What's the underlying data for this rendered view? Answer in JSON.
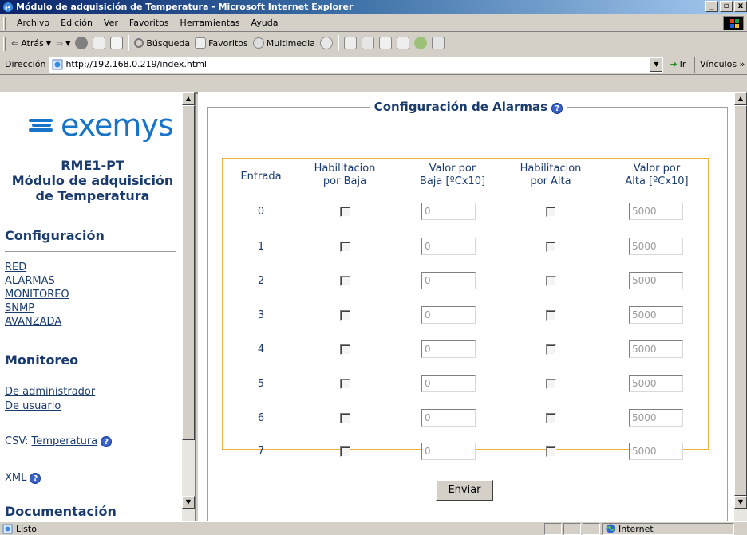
{
  "window": {
    "title": "Módulo de adquisición de Temperatura - Microsoft Internet Explorer",
    "controls": [
      "_",
      "▫",
      "x"
    ]
  },
  "menubar": [
    "Archivo",
    "Edición",
    "Ver",
    "Favoritos",
    "Herramientas",
    "Ayuda"
  ],
  "toolbar": {
    "back": "Atrás",
    "search": "Búsqueda",
    "favorites": "Favoritos",
    "multimedia": "Multimedia"
  },
  "address": {
    "label": "Dirección",
    "url": "http://192.168.0.219/index.html",
    "go": "Ir",
    "links": "Vínculos"
  },
  "sidebar": {
    "brand": "exemys",
    "product_line1": "RME1-PT",
    "product_line2": "Módulo de adquisición",
    "product_line3": "de Temperatura",
    "config_title": "Configuración",
    "config_links": [
      "RED",
      "ALARMAS",
      "MONITOREO",
      "SNMP",
      "AVANZADA"
    ],
    "monitor_title": "Monitoreo",
    "monitor_links": [
      "De administrador",
      "De usuario"
    ],
    "csv_prefix": "CSV:",
    "csv_link": "Temperatura",
    "xml_link": "XML",
    "doc_title": "Documentación"
  },
  "main": {
    "legend": "Configuración de Alarmas",
    "headers": {
      "entrada": "Entrada",
      "hab_baja_1": "Habilitacion",
      "hab_baja_2": "por Baja",
      "val_baja_1": "Valor por",
      "val_baja_2": "Baja [ºCx10]",
      "hab_alta_1": "Habilitacion",
      "hab_alta_2": "por Alta",
      "val_alta_1": "Valor por",
      "val_alta_2": "Alta [ºCx10]"
    },
    "rows": [
      {
        "entrada": "0",
        "baja": "0",
        "alta": "5000"
      },
      {
        "entrada": "1",
        "baja": "0",
        "alta": "5000"
      },
      {
        "entrada": "2",
        "baja": "0",
        "alta": "5000"
      },
      {
        "entrada": "3",
        "baja": "0",
        "alta": "5000"
      },
      {
        "entrada": "4",
        "baja": "0",
        "alta": "5000"
      },
      {
        "entrada": "5",
        "baja": "0",
        "alta": "5000"
      },
      {
        "entrada": "6",
        "baja": "0",
        "alta": "5000"
      },
      {
        "entrada": "7",
        "baja": "0",
        "alta": "5000"
      }
    ],
    "submit": "Enviar"
  },
  "status": {
    "text": "Listo",
    "zone": "Internet"
  },
  "colors": {
    "brand_blue": "#1874c8",
    "heading_navy": "#1a3b6e",
    "table_border": "#f0b040",
    "title_bar": "#0a246a"
  }
}
